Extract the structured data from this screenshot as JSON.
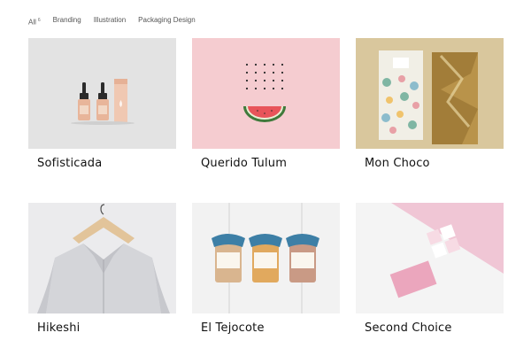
{
  "filters": [
    {
      "label": "All",
      "count": "6"
    },
    {
      "label": "Branding"
    },
    {
      "label": "Illustration"
    },
    {
      "label": "Packaging Design"
    }
  ],
  "projects": [
    {
      "title": "Sofisticada",
      "bg": "#e2e2e2"
    },
    {
      "title": "Querido Tulum",
      "bg": "#f4cdcf"
    },
    {
      "title": "Mon Choco",
      "bg": "#d8c79c"
    },
    {
      "title": "Hikeshi",
      "bg": "#e6e6e8"
    },
    {
      "title": "El Tejocote",
      "bg": "#f1f1f1"
    },
    {
      "title": "Second Choice",
      "bg": "#f3f3f3"
    }
  ]
}
